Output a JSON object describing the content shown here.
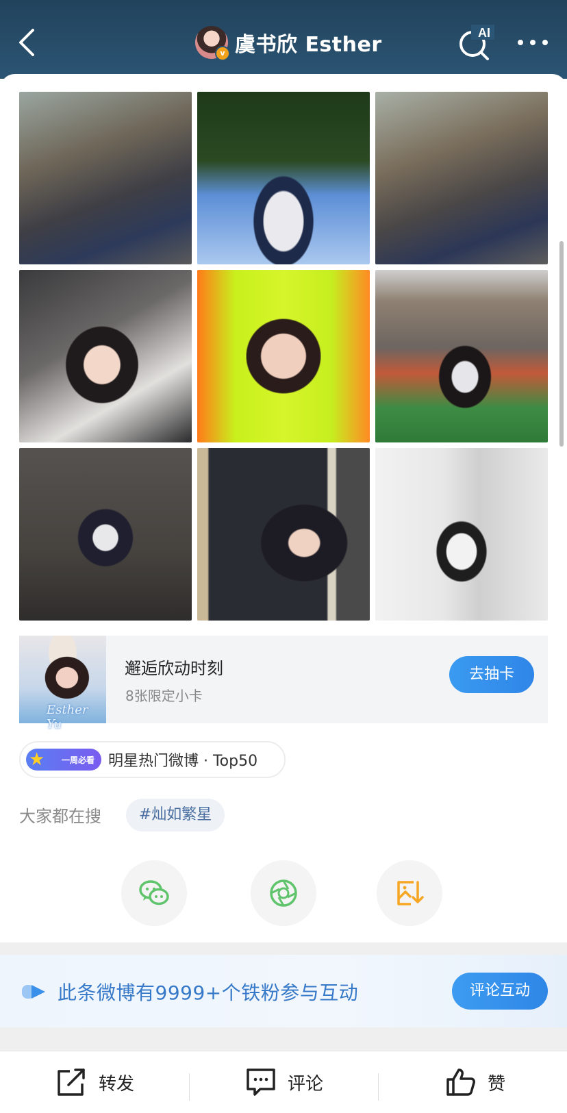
{
  "header": {
    "title": "虞书欣 Esther",
    "verified_badge": "v",
    "ai_label": "AI",
    "icons": [
      "back-icon",
      "ai-search-icon",
      "more-icon"
    ]
  },
  "photos": [
    {
      "name": "photo-1"
    },
    {
      "name": "photo-2"
    },
    {
      "name": "photo-3"
    },
    {
      "name": "photo-4"
    },
    {
      "name": "photo-5"
    },
    {
      "name": "photo-6"
    },
    {
      "name": "photo-7"
    },
    {
      "name": "photo-8"
    },
    {
      "name": "photo-9"
    }
  ],
  "promo": {
    "title": "邂逅欣动时刻",
    "subtitle": "8张限定小卡",
    "button": "去抽卡",
    "thumb_signature": "Esther Yu"
  },
  "hot": {
    "badge": "一周必看",
    "text": "明星热门微博 · Top50"
  },
  "search": {
    "label": "大家都在搜",
    "tag": "#灿如繁星"
  },
  "share": {
    "icons": [
      "wechat-icon",
      "moments-icon",
      "save-image-icon"
    ]
  },
  "fan_bar": {
    "text": "此条微博有9999+个铁粉参与互动",
    "button": "评论互动"
  },
  "bottom_bar": {
    "repost": "转发",
    "comment": "评论",
    "like": "赞"
  },
  "colors": {
    "header_bg": "#2b5574",
    "accent_blue": "#2f86e8",
    "wechat_green": "#5fc46b",
    "save_orange": "#f5a623"
  }
}
